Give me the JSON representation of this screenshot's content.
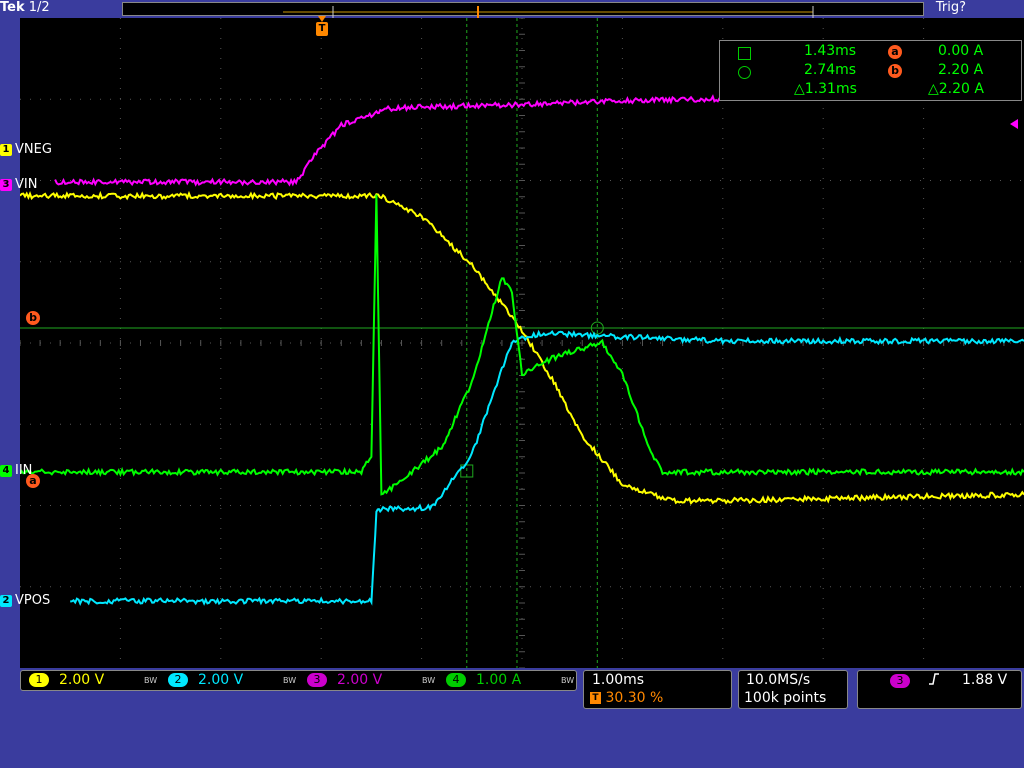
{
  "header": {
    "brand": "Tek",
    "page": "1/2",
    "trigger_status": "Trig?"
  },
  "channel_labels": [
    {
      "num": "1",
      "name": "VNEG",
      "color": "#ffff00"
    },
    {
      "num": "3",
      "name": "VIN",
      "color": "#ff00ff"
    },
    {
      "num": "4",
      "name": "IIN",
      "color": "#00ff00"
    },
    {
      "num": "2",
      "name": "VPOS",
      "color": "#00e8ff"
    }
  ],
  "cursor_markers": {
    "a": "a",
    "b": "b",
    "trigger": "T"
  },
  "cursor_readout": {
    "t1": "1.43ms",
    "t2": "2.74ms",
    "dt": "△1.31ms",
    "va": "0.00 A",
    "vb": "2.20 A",
    "dv": "△2.20 A"
  },
  "channels_bar": [
    {
      "num": "1",
      "scale": "2.00 V",
      "color": "#ffff00",
      "bw": "BW"
    },
    {
      "num": "2",
      "scale": "2.00 V",
      "color": "#00e8ff",
      "bw": "BW"
    },
    {
      "num": "3",
      "scale": "2.00 V",
      "color": "#cc00cc",
      "bw": "BW"
    },
    {
      "num": "4",
      "scale": "1.00 A",
      "color": "#00cc00",
      "bw": "BW"
    }
  ],
  "timebase": {
    "scale": "1.00ms",
    "trigger_pos": "30.30 %"
  },
  "acquisition": {
    "rate": "10.0MS/s",
    "points": "100k points"
  },
  "trigger": {
    "source": "3",
    "slope": "rising",
    "level": "1.88 V"
  },
  "chart_data": {
    "type": "line",
    "xlabel": "",
    "ylabel": "",
    "x_divisions": 10,
    "y_divisions": 8,
    "grid": true,
    "series": [
      {
        "name": "VNEG",
        "color": "#ffff00",
        "x": [
          0,
          3.6,
          4.0,
          4.5,
          5.0,
          5.3,
          5.6,
          6.0,
          6.5,
          7.0,
          8.0,
          9.0,
          10.0
        ],
        "y": [
          5.3,
          5.3,
          4.8,
          3.6,
          2.0,
          0.8,
          -0.6,
          -1.8,
          -2.2,
          -2.2,
          -2.15,
          -2.1,
          -2.05
        ]
      },
      {
        "name": "VPOS",
        "color": "#00e8ff",
        "x": [
          0.5,
          3.5,
          3.55,
          3.6,
          4.1,
          4.5,
          4.9,
          5.2,
          6.0,
          7.0,
          8.0,
          10.0
        ],
        "y": [
          -2.5,
          -2.5,
          -0.3,
          -0.25,
          -0.2,
          1.1,
          3.9,
          4.1,
          4.0,
          3.9,
          3.9,
          3.9
        ]
      },
      {
        "name": "VIN",
        "color": "#ff00ff",
        "x": [
          0.35,
          2.75,
          2.95,
          3.2,
          3.55,
          3.6,
          4.0,
          5.0,
          6.0,
          7.0
        ],
        "y": [
          4.7,
          4.7,
          5.4,
          6.1,
          6.4,
          6.5,
          6.55,
          6.6,
          6.7,
          6.75
        ]
      },
      {
        "name": "IIN",
        "color": "#00ff00",
        "x": [
          0,
          3.4,
          3.5,
          3.55,
          3.6,
          4.2,
          4.5,
          4.8,
          4.9,
          5.0,
          5.3,
          5.8,
          6.0,
          6.3,
          6.4,
          10.0
        ],
        "y": [
          0.0,
          0.0,
          0.2,
          3.4,
          -0.3,
          0.3,
          1.1,
          2.4,
          2.2,
          1.2,
          1.4,
          1.6,
          1.2,
          0.2,
          0.0,
          0.0
        ]
      }
    ]
  }
}
